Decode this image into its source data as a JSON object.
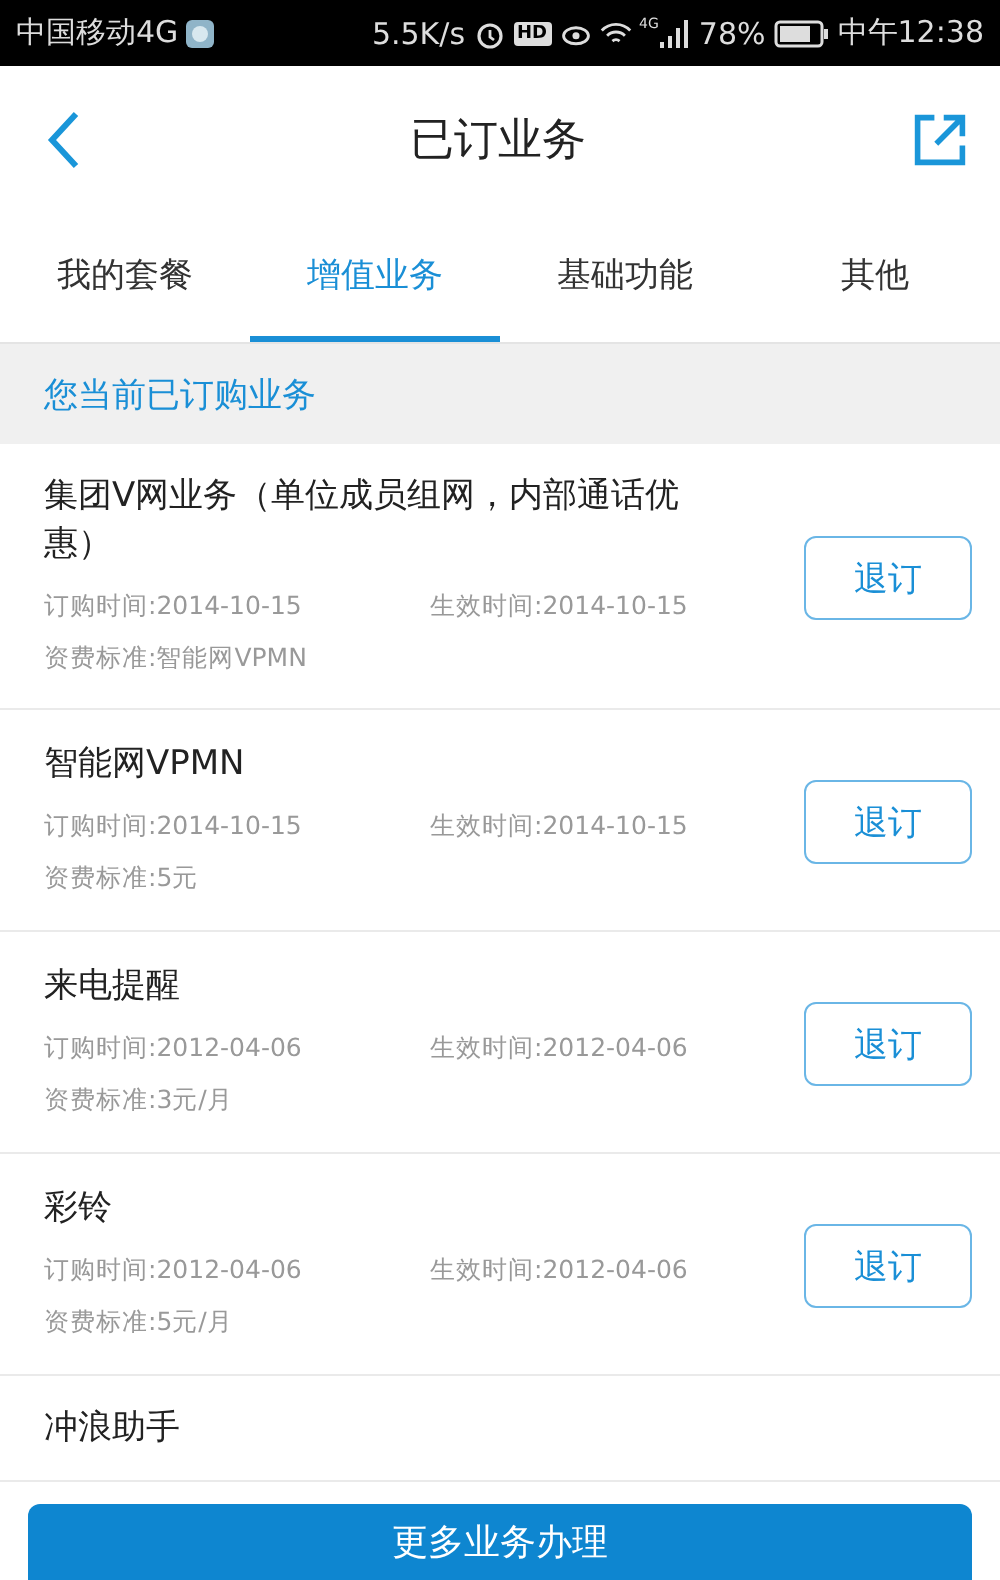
{
  "status_bar": {
    "carrier": "中国移动4G",
    "speed": "5.5K/s",
    "hd": "HD",
    "network": "4G",
    "battery": "78%",
    "time": "中午12:38"
  },
  "header": {
    "title": "已订业务"
  },
  "tabs": [
    {
      "label": "我的套餐",
      "selected": false
    },
    {
      "label": "增值业务",
      "selected": true
    },
    {
      "label": "基础功能",
      "selected": false
    },
    {
      "label": "其他",
      "selected": false
    }
  ],
  "section": {
    "title": "您当前已订购业务"
  },
  "services": [
    {
      "name": "集团V网业务（单位成员组网，内部通话优惠）",
      "order_time": "订购时间:2014-10-15",
      "effective_time": "生效时间:2014-10-15",
      "fee": "资费标准:智能网VPMN",
      "button": "退订"
    },
    {
      "name": "智能网VPMN",
      "order_time": "订购时间:2014-10-15",
      "effective_time": "生效时间:2014-10-15",
      "fee": "资费标准:5元",
      "button": "退订"
    },
    {
      "name": "来电提醒",
      "order_time": "订购时间:2012-04-06",
      "effective_time": "生效时间:2012-04-06",
      "fee": "资费标准:3元/月",
      "button": "退订"
    },
    {
      "name": "彩铃",
      "order_time": "订购时间:2012-04-06",
      "effective_time": "生效时间:2012-04-06",
      "fee": "资费标准:5元/月",
      "button": "退订"
    },
    {
      "name": "冲浪助手"
    }
  ],
  "bottom_button": "更多业务办理"
}
